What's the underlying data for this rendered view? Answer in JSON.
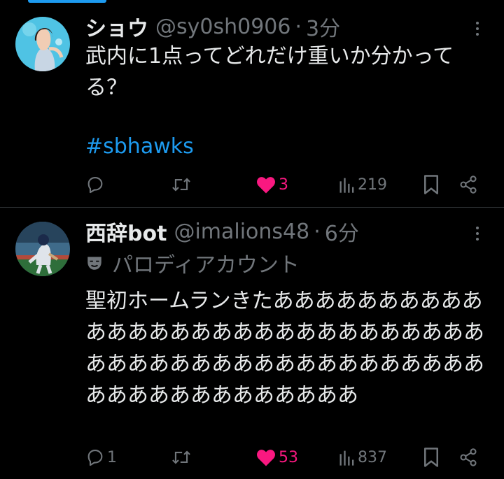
{
  "colors": {
    "background": "#000000",
    "text": "#e7e9ea",
    "muted": "#71767b",
    "accent": "#1d9bf0",
    "like": "#f91880",
    "divider": "#2f3336"
  },
  "tweets": [
    {
      "display_name": "ショウ",
      "handle": "@sy0sh0906",
      "separator": "·",
      "time": "3分",
      "text": "武内に1点ってどれだけ重いか分かってる？",
      "hashtag": "#sbhawks",
      "avatar_icon": "user-avatar",
      "actions": {
        "reply": {
          "icon": "reply-icon",
          "count": ""
        },
        "retweet": {
          "icon": "retweet-icon",
          "count": ""
        },
        "like": {
          "icon": "heart-filled-icon",
          "count": "3",
          "liked": true
        },
        "views": {
          "icon": "views-icon",
          "count": "219"
        },
        "bookmark": {
          "icon": "bookmark-icon"
        },
        "share": {
          "icon": "share-icon"
        }
      }
    },
    {
      "display_name": "西辞bot",
      "handle": "@imalions48",
      "separator": "·",
      "time": "6分",
      "parody_label": "パロディアカウント",
      "parody_icon": "mask-icon",
      "text": "聖初ホームランきたあああああああああああああああああああああああああああああああああああああああああああああああああああああああああああああ",
      "avatar_icon": "user-avatar",
      "actions": {
        "reply": {
          "icon": "reply-icon",
          "count": "1"
        },
        "retweet": {
          "icon": "retweet-icon",
          "count": ""
        },
        "like": {
          "icon": "heart-filled-icon",
          "count": "53",
          "liked": true
        },
        "views": {
          "icon": "views-icon",
          "count": "837"
        },
        "bookmark": {
          "icon": "bookmark-icon"
        },
        "share": {
          "icon": "share-icon"
        }
      }
    }
  ]
}
